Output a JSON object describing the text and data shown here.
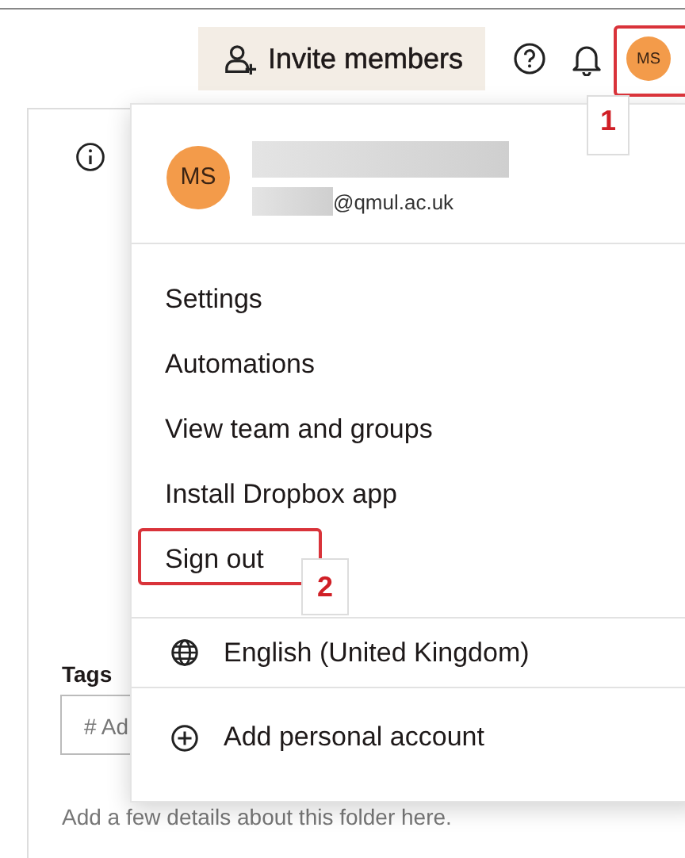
{
  "header": {
    "invite_button": "Invite members"
  },
  "user_avatar": "MS",
  "panel": {
    "tags_label": "Tags",
    "tags_placeholder": "# Ad",
    "description_hint": "Add a few details about this folder here."
  },
  "account_menu": {
    "avatar": "MS",
    "email": "@qmul.ac.uk",
    "items": [
      "Settings",
      "Automations",
      "View team and groups",
      "Install Dropbox app",
      "Sign out"
    ],
    "footer_items": [
      {
        "kind": "globe",
        "label": "English (United Kingdom)"
      },
      {
        "kind": "add",
        "label": "Add personal account"
      }
    ]
  },
  "annotations": [
    {
      "kind": "header",
      "label": "1"
    },
    {
      "kind": "menu",
      "label": "2"
    }
  ]
}
